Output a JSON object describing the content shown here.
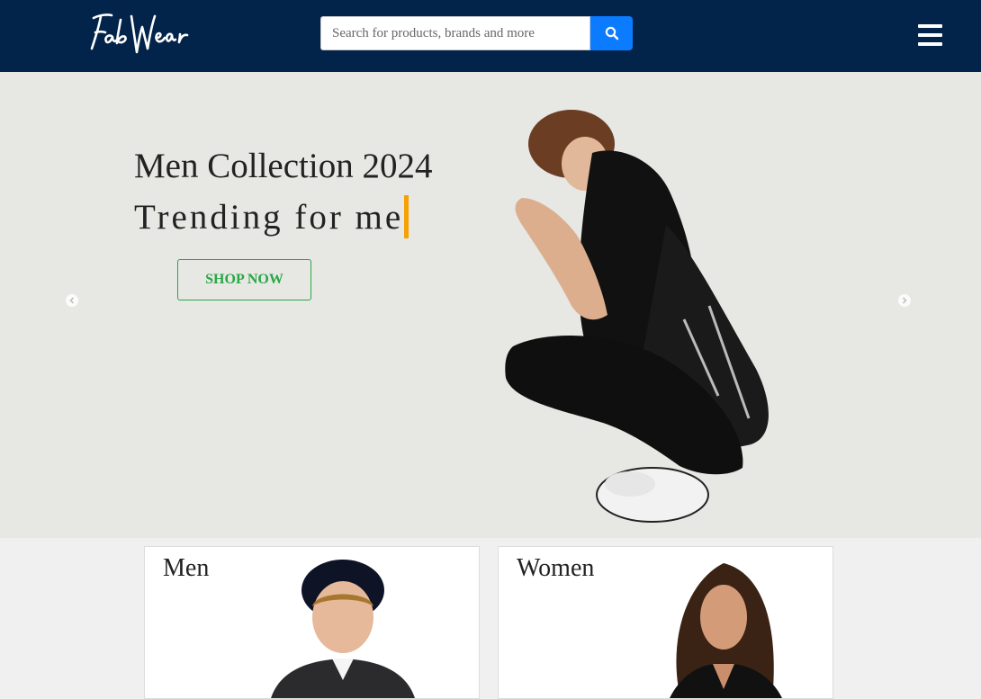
{
  "brand": {
    "logo_text": "Fab Wear"
  },
  "search": {
    "placeholder": "Search for products, brands and more",
    "button_icon": "search-icon"
  },
  "nav": {
    "menu_icon": "hamburger-icon"
  },
  "hero": {
    "title": "Men Collection 2024",
    "subtitle": "Trending for me",
    "cta_label": "SHOP NOW",
    "caret_color": "#f5a100",
    "cta_color": "#28a745"
  },
  "categories": [
    {
      "label": "Men"
    },
    {
      "label": "Women"
    }
  ],
  "colors": {
    "navbar": "#03244a",
    "search_button": "#0b7bff",
    "hero_bg": "#e7e7e3"
  }
}
